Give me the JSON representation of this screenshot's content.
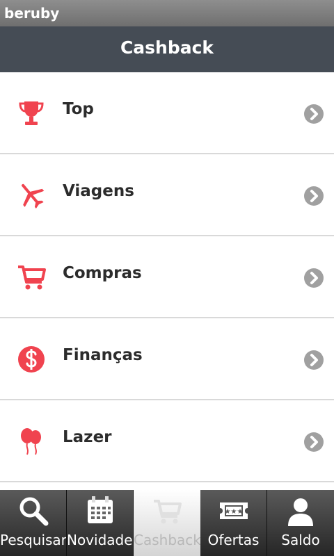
{
  "statusbar": {
    "app_name": "beruby"
  },
  "header": {
    "title": "Cashback"
  },
  "list": {
    "items": [
      {
        "label": "Top",
        "icon": "trophy-icon"
      },
      {
        "label": "Viagens",
        "icon": "airplane-icon"
      },
      {
        "label": "Compras",
        "icon": "shopping-cart-icon"
      },
      {
        "label": "Finanças",
        "icon": "dollar-coin-icon"
      },
      {
        "label": "Lazer",
        "icon": "balloons-icon"
      }
    ]
  },
  "tabbar": {
    "tabs": [
      {
        "label": "Pesquisar",
        "icon": "search-icon"
      },
      {
        "label": "Novidades",
        "icon": "calendar-icon"
      },
      {
        "label": "Cashback",
        "icon": "cart-icon",
        "active": true
      },
      {
        "label": "Ofertas",
        "icon": "ticket-icon"
      },
      {
        "label": "Saldo",
        "icon": "user-icon"
      }
    ]
  },
  "colors": {
    "accent": "#f0434f",
    "header_bg": "#454c55",
    "chevron": "#a0a0a0"
  }
}
